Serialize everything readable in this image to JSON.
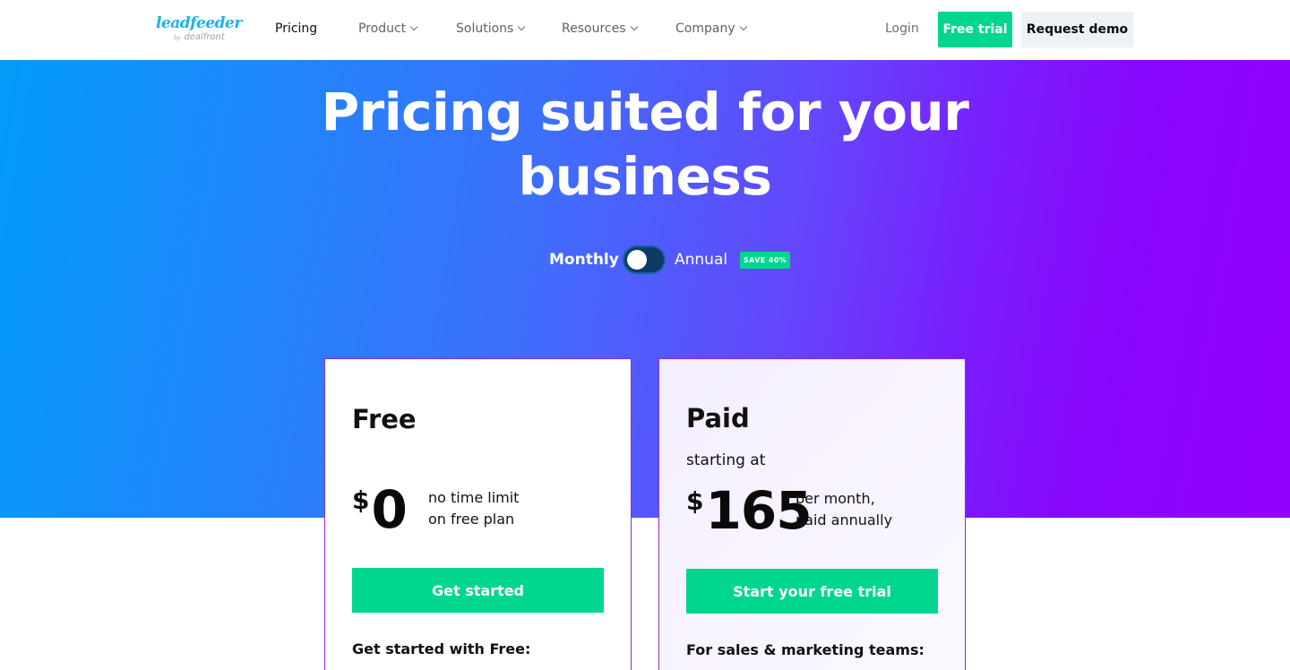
{
  "header": {
    "logo": {
      "main": "leadfeeder",
      "by": "by",
      "sub": "dealfront"
    },
    "nav": [
      {
        "label": "Pricing",
        "has_dropdown": false
      },
      {
        "label": "Product",
        "has_dropdown": true
      },
      {
        "label": "Solutions",
        "has_dropdown": true
      },
      {
        "label": "Resources",
        "has_dropdown": true
      },
      {
        "label": "Company",
        "has_dropdown": true
      }
    ],
    "login_label": "Login",
    "free_trial_label": "Free trial",
    "request_demo_label": "Request demo"
  },
  "hero": {
    "title_line1": "Pricing suited for your",
    "title_line2": "business",
    "billing_toggle": {
      "monthly_label": "Monthly",
      "annual_label": "Annual",
      "selected": "Monthly",
      "save_badge": "SAVE 40%"
    }
  },
  "plans": {
    "free": {
      "name": "Free",
      "currency": "$",
      "price": "0",
      "note_line1": "no time limit",
      "note_line2": "on free plan",
      "cta_label": "Get started",
      "features_heading": "Get started with Free:"
    },
    "paid": {
      "name": "Paid",
      "starting_label": "starting at",
      "currency": "$",
      "price": "165",
      "note_line1": "per month,",
      "note_line2": "paid annually",
      "cta_label": "Start your free trial",
      "features_heading": "For sales & marketing teams:"
    }
  },
  "colors": {
    "accent_green": "#00d68f",
    "hero_gradient_start": "#039cf9",
    "hero_gradient_end": "#9000fb",
    "card_border": "#8a2be2",
    "logo_blue": "#1bb3e6"
  }
}
